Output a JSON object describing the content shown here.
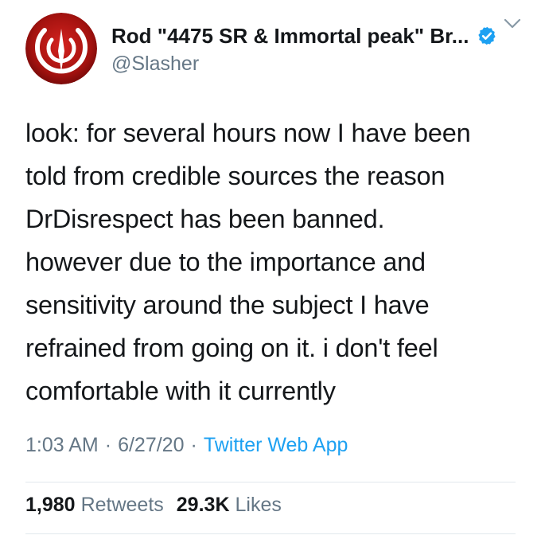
{
  "tweet": {
    "author": {
      "display_name": "Rod \"4475 SR & Immortal peak\" Br...",
      "handle": "@Slasher",
      "verified": true,
      "avatar_icon": "quake-logo-icon",
      "avatar_colors": {
        "outer": "#7a0c0c",
        "inner": "#c21b1b",
        "logo": "#ffffff"
      }
    },
    "more_icon": "chevron-down-icon",
    "verified_color": "#1da1f2",
    "body_lines": [
      "look: for several hours now I have been",
      "told from credible sources the reason",
      "DrDisrespect has been banned.",
      "however due to the importance and",
      "sensitivity around the subject I have",
      "refrained from going on it. i don't feel",
      "comfortable with it currently"
    ],
    "meta": {
      "time": "1:03 AM",
      "separator": "·",
      "date": "6/27/20",
      "source": "Twitter Web App"
    },
    "stats": {
      "retweets_count": "1,980",
      "retweets_label": "Retweets",
      "likes_count": "29.3K",
      "likes_label": "Likes"
    }
  }
}
